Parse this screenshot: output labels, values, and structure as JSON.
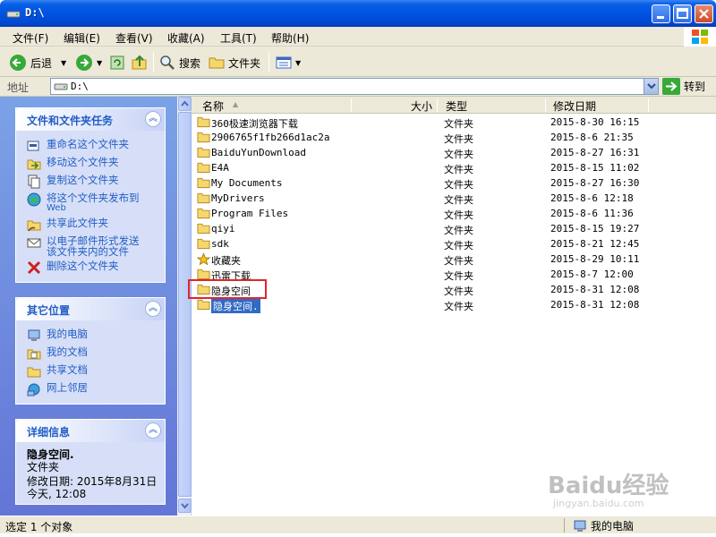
{
  "window": {
    "title": "D:\\"
  },
  "menu": [
    "文件(F)",
    "编辑(E)",
    "查看(V)",
    "收藏(A)",
    "工具(T)",
    "帮助(H)"
  ],
  "toolbar": {
    "back_label": "后退",
    "search_label": "搜索",
    "folders_label": "文件夹"
  },
  "address": {
    "label": "地址",
    "value": "D:\\",
    "go_label": "转到"
  },
  "tasks_panel": {
    "title": "文件和文件夹任务",
    "items": [
      "重命名这个文件夹",
      "移动这个文件夹",
      "复制这个文件夹",
      "将这个文件夹发布到",
      "Web",
      "共享此文件夹",
      "以电子邮件形式发送",
      "该文件夹内的文件",
      "删除这个文件夹"
    ]
  },
  "other_panel": {
    "title": "其它位置",
    "items": [
      "我的电脑",
      "我的文档",
      "共享文档",
      "网上邻居"
    ]
  },
  "details_panel": {
    "title": "详细信息",
    "name": "隐身空间.",
    "type": "文件夹",
    "modified_line1": "修改日期: 2015年8月31日",
    "modified_line2": "今天, 12:08"
  },
  "columns": {
    "name": "名称",
    "size": "大小",
    "type": "类型",
    "date": "修改日期"
  },
  "files": [
    {
      "name": "360极速浏览器下载",
      "type": "文件夹",
      "date": "2015-8-30 16:15",
      "icon": "folder-icon"
    },
    {
      "name": "2906765f1fb266d1ac2a",
      "type": "文件夹",
      "date": "2015-8-6 21:35",
      "icon": "folder-icon"
    },
    {
      "name": "BaiduYunDownload",
      "type": "文件夹",
      "date": "2015-8-27 16:31",
      "icon": "folder-icon"
    },
    {
      "name": "E4A",
      "type": "文件夹",
      "date": "2015-8-15 11:02",
      "icon": "folder-icon"
    },
    {
      "name": "My Documents",
      "type": "文件夹",
      "date": "2015-8-27 16:30",
      "icon": "folder-icon"
    },
    {
      "name": "MyDrivers",
      "type": "文件夹",
      "date": "2015-8-6 12:18",
      "icon": "folder-icon"
    },
    {
      "name": "Program Files",
      "type": "文件夹",
      "date": "2015-8-6 11:36",
      "icon": "folder-icon"
    },
    {
      "name": "qiyi",
      "type": "文件夹",
      "date": "2015-8-15 19:27",
      "icon": "folder-icon"
    },
    {
      "name": "sdk",
      "type": "文件夹",
      "date": "2015-8-21 12:45",
      "icon": "folder-icon"
    },
    {
      "name": "收藏夹",
      "type": "文件夹",
      "date": "2015-8-29 10:11",
      "icon": "star-folder-icon"
    },
    {
      "name": "迅雷下载",
      "type": "文件夹",
      "date": "2015-8-7 12:00",
      "icon": "folder-icon"
    },
    {
      "name": "隐身空间",
      "type": "文件夹",
      "date": "2015-8-31 12:08",
      "icon": "folder-icon"
    },
    {
      "name": "隐身空间.",
      "type": "文件夹",
      "date": "2015-8-31 12:08",
      "icon": "folder-icon"
    }
  ],
  "status": {
    "left": "选定 1 个对象",
    "right": "我的电脑"
  },
  "watermark": {
    "main": "Baidu经验",
    "sub": "jingyan.baidu.com"
  },
  "colors": {
    "accent": "#316ac5",
    "highlight_border": "#e0262a",
    "taskpane": "#6375d6"
  }
}
